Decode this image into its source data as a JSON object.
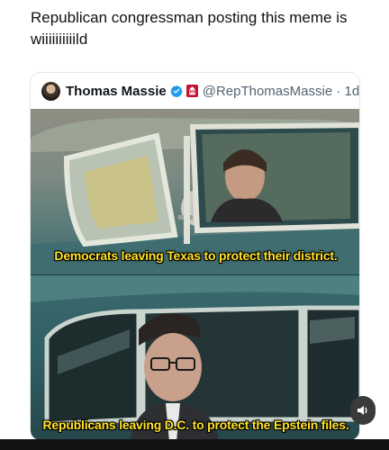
{
  "post": {
    "text": "Republican congressman posting this meme is wiiiiiiiiiild"
  },
  "quote": {
    "author_name": "Thomas Massie",
    "handle_line": "@RepThomasMassie · 1d",
    "avatar_icon": "avatar-photo",
    "verified_icon": "verified-badge-icon",
    "affiliation_icon": "us-capitol-affiliation-icon"
  },
  "meme": {
    "top_caption": "Democrats leaving Texas to protect their district.",
    "bottom_caption": "Republicans leaving D.C. to protect the Epstein files."
  },
  "controls": {
    "audio_icon": "speaker-icon"
  },
  "colors": {
    "caption": "#ffe227",
    "verified": "#1d9bf0",
    "affiliation": "#c4122f",
    "handle": "#536471"
  }
}
